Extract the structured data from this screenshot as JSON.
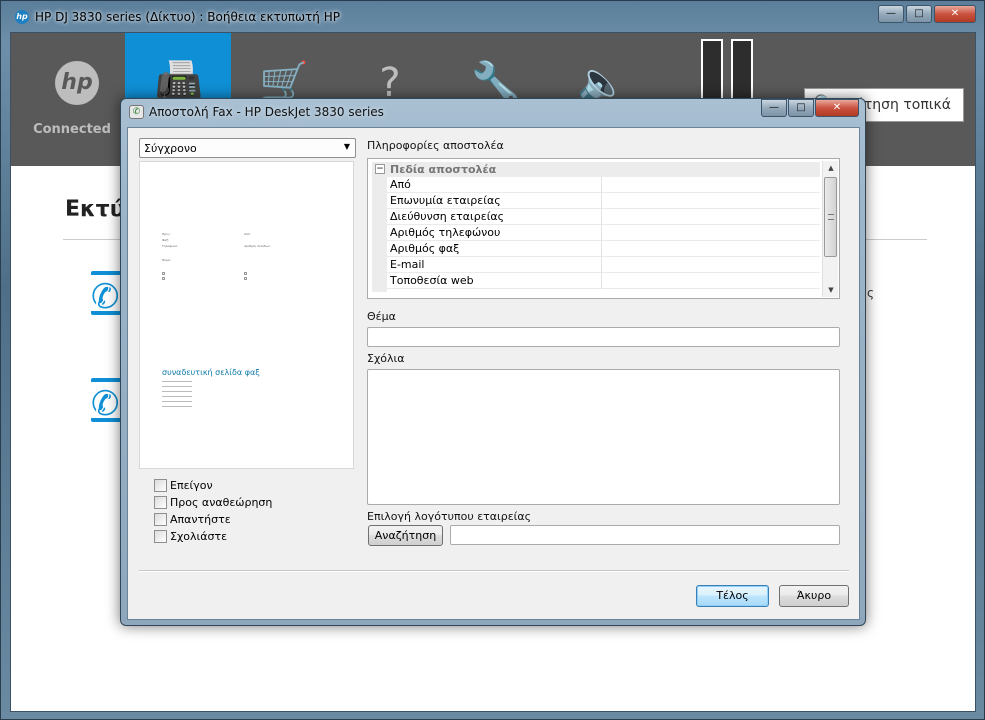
{
  "outer_window": {
    "title": "HP DJ 3830 series (Δίκτυο) : Βοήθεια εκτυπωτή HP",
    "controls": {
      "minimize": "—",
      "maximize": "□",
      "close": "✕"
    }
  },
  "nav": {
    "connected_label": "Connected",
    "search_placeholder": "ήτηση τοπικά"
  },
  "background": {
    "heading": "Εκτύ",
    "fragment": "ς"
  },
  "fax_dialog": {
    "title": "Αποστολή Fax - HP DeskJet 3830 series",
    "controls": {
      "minimize": "—",
      "maximize": "□",
      "close": "✕"
    },
    "template_select": {
      "value": "Σύγχρονο"
    },
    "preview": {
      "cover_title": "συναδευτική σελίδα φαξ",
      "mini_lines": [
        "Προς:",
        "Φαξ:",
        "Τηλέφωνο:",
        "Από:",
        "Αριθμός σελίδων:",
        "Θέμα:"
      ]
    },
    "checkboxes": [
      {
        "label": "Επείγον",
        "checked": false
      },
      {
        "label": "Προς αναθεώρηση",
        "checked": false
      },
      {
        "label": "Απαντήστε",
        "checked": false
      },
      {
        "label": "Σχολιάστε",
        "checked": false
      }
    ],
    "sender_info_label": "Πληροφορίες αποστολέα",
    "sender_grid": {
      "group_label": "Πεδία αποστολέα",
      "rows": [
        {
          "name": "Από",
          "value": ""
        },
        {
          "name": "Επωνυμία εταιρείας",
          "value": ""
        },
        {
          "name": "Διεύθυνση εταιρείας",
          "value": ""
        },
        {
          "name": "Αριθμός τηλεφώνου",
          "value": ""
        },
        {
          "name": "Αριθμός φαξ",
          "value": ""
        },
        {
          "name": "E-mail",
          "value": ""
        },
        {
          "name": "Τοποθεσία web",
          "value": ""
        }
      ]
    },
    "subject_label": "Θέμα",
    "subject_value": "",
    "comments_label": "Σχόλια",
    "comments_value": "",
    "logo_label": "Επιλογή λογότυπου εταιρείας",
    "browse_button": "Αναζήτηση",
    "logo_path": "",
    "finish_button": "Τέλος",
    "cancel_button": "Άκυρο"
  }
}
